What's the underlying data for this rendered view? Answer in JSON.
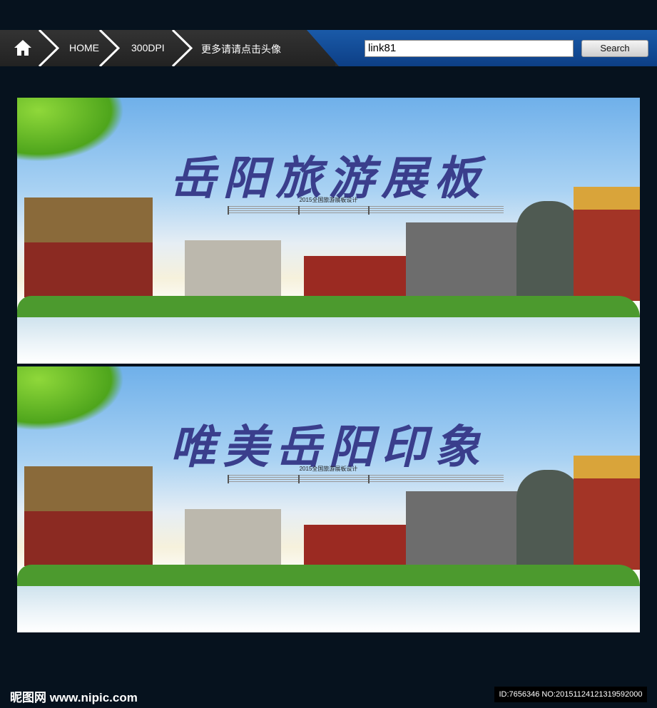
{
  "nav": {
    "home_icon": "home-icon",
    "crumbs": [
      "HOME",
      "300DPI",
      "更多请请点击头像"
    ],
    "search_value": "link81",
    "search_button": "Search",
    "colors": {
      "bar": "#2a2a2a",
      "blue": "#0d3f86"
    }
  },
  "panels": [
    {
      "title": "岳阳旅游展板",
      "subtitle": "2015全国旅游展板设计"
    },
    {
      "title": "唯美岳阳印象",
      "subtitle": "2015全国旅游展板设计"
    }
  ],
  "footer": {
    "watermark": "昵图网 www.nipic.com",
    "id_text": "ID:7656346 NO:20151124121319592000"
  }
}
